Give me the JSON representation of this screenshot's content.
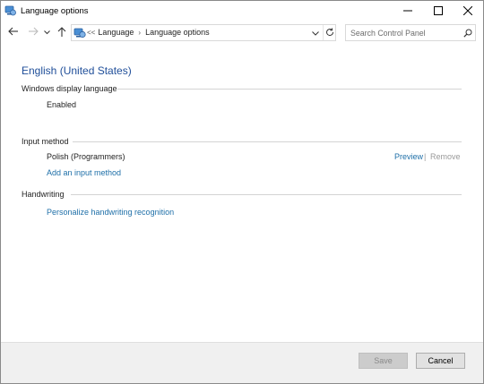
{
  "window": {
    "title": "Language options",
    "app_icon": "control-panel-icon"
  },
  "window_controls": {
    "minimize_icon": "minimize-icon",
    "maximize_icon": "maximize-icon",
    "close_icon": "close-icon"
  },
  "nav": {
    "back_icon": "arrow-left-icon",
    "forward_icon": "arrow-right-icon",
    "recent_icon": "chevron-down-icon",
    "up_icon": "arrow-up-icon"
  },
  "address": {
    "overflow": "<<",
    "breadcrumbs": [
      "Language",
      "Language options"
    ],
    "dropdown_icon": "chevron-down-icon",
    "refresh_icon": "refresh-icon"
  },
  "search": {
    "placeholder": "Search Control Panel",
    "icon": "search-icon"
  },
  "main": {
    "language_name": "English (United States)",
    "display_language": {
      "heading": "Windows display language",
      "status": "Enabled"
    },
    "input_method": {
      "heading": "Input method",
      "item": "Polish (Programmers)",
      "preview_link": "Preview",
      "separator": "|",
      "remove_link": "Remove",
      "add_link": "Add an input method"
    },
    "handwriting": {
      "heading": "Handwriting",
      "personalize_link": "Personalize handwriting recognition"
    }
  },
  "footer": {
    "save_label": "Save",
    "cancel_label": "Cancel"
  },
  "colors": {
    "link": "#1e6fa8",
    "title": "#1f4e99",
    "footer_bg": "#f0f0f0"
  }
}
